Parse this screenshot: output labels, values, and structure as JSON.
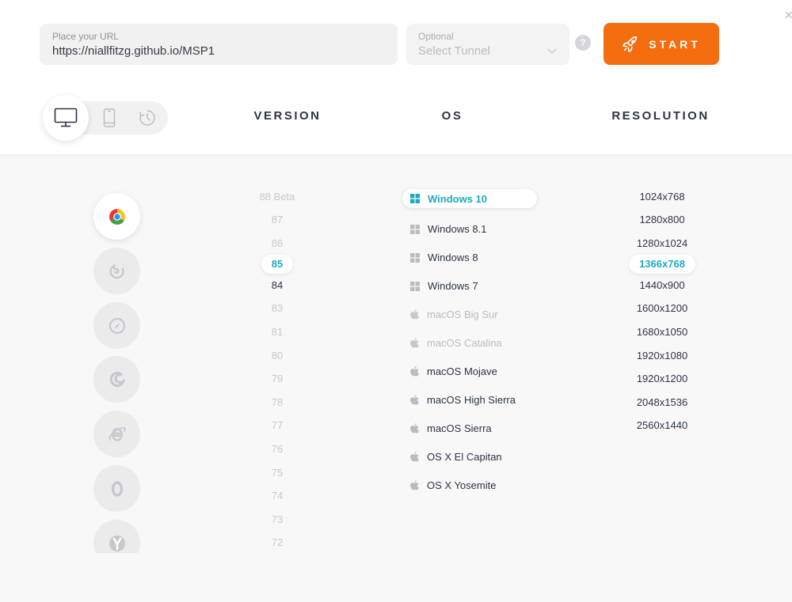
{
  "form": {
    "url_label": "Place your URL",
    "url_value": "https://niallfitzg.github.io/MSP1",
    "tunnel_label": "Optional",
    "tunnel_placeholder": "Select Tunnel",
    "help_glyph": "?",
    "start_label": "START"
  },
  "columns": {
    "version": "VERSION",
    "os": "OS",
    "resolution": "RESOLUTION"
  },
  "device_tabs": [
    "desktop-icon",
    "mobile-icon",
    "recent-icon"
  ],
  "browsers": [
    {
      "icon": "chrome-icon",
      "selected": true
    },
    {
      "icon": "firefox-icon",
      "selected": false
    },
    {
      "icon": "safari-icon",
      "selected": false
    },
    {
      "icon": "edge-icon",
      "selected": false
    },
    {
      "icon": "ie-icon",
      "selected": false
    },
    {
      "icon": "opera-icon",
      "selected": false
    },
    {
      "icon": "yandex-icon",
      "selected": false
    }
  ],
  "versions": [
    {
      "label": "88 Beta",
      "state": "muted"
    },
    {
      "label": "87",
      "state": "muted"
    },
    {
      "label": "86",
      "state": "muted"
    },
    {
      "label": "85",
      "state": "selected"
    },
    {
      "label": "84",
      "state": "dark"
    },
    {
      "label": "83",
      "state": "muted"
    },
    {
      "label": "81",
      "state": "muted"
    },
    {
      "label": "80",
      "state": "muted"
    },
    {
      "label": "79",
      "state": "muted"
    },
    {
      "label": "78",
      "state": "muted"
    },
    {
      "label": "77",
      "state": "muted"
    },
    {
      "label": "76",
      "state": "muted"
    },
    {
      "label": "75",
      "state": "muted"
    },
    {
      "label": "74",
      "state": "muted"
    },
    {
      "label": "73",
      "state": "muted"
    },
    {
      "label": "72",
      "state": "muted"
    }
  ],
  "os_list": [
    {
      "label": "Windows 10",
      "icon": "windows-icon",
      "state": "selected"
    },
    {
      "label": "Windows 8.1",
      "icon": "windows-icon",
      "state": "normal"
    },
    {
      "label": "Windows 8",
      "icon": "windows-icon",
      "state": "normal"
    },
    {
      "label": "Windows 7",
      "icon": "windows-icon",
      "state": "normal"
    },
    {
      "label": "macOS Big Sur",
      "icon": "apple-icon",
      "state": "muted"
    },
    {
      "label": "macOS Catalina",
      "icon": "apple-icon",
      "state": "muted"
    },
    {
      "label": "macOS Mojave",
      "icon": "apple-icon",
      "state": "normal"
    },
    {
      "label": "macOS High Sierra",
      "icon": "apple-icon",
      "state": "normal"
    },
    {
      "label": "macOS Sierra",
      "icon": "apple-icon",
      "state": "normal"
    },
    {
      "label": "OS X El Capitan",
      "icon": "apple-icon",
      "state": "normal"
    },
    {
      "label": "OS X Yosemite",
      "icon": "apple-icon",
      "state": "normal"
    }
  ],
  "resolutions": [
    {
      "label": "1024x768",
      "state": "normal"
    },
    {
      "label": "1280x800",
      "state": "normal"
    },
    {
      "label": "1280x1024",
      "state": "normal"
    },
    {
      "label": "1366x768",
      "state": "selected"
    },
    {
      "label": "1440x900",
      "state": "normal"
    },
    {
      "label": "1600x1200",
      "state": "normal"
    },
    {
      "label": "1680x1050",
      "state": "normal"
    },
    {
      "label": "1920x1080",
      "state": "normal"
    },
    {
      "label": "1920x1200",
      "state": "normal"
    },
    {
      "label": "2048x1536",
      "state": "normal"
    },
    {
      "label": "2560x1440",
      "state": "normal"
    }
  ],
  "colors": {
    "accent": "#1fa9c1",
    "start_button": "#f46d0f",
    "text_dark": "#2c3444",
    "text_muted": "#c5c8cd"
  }
}
